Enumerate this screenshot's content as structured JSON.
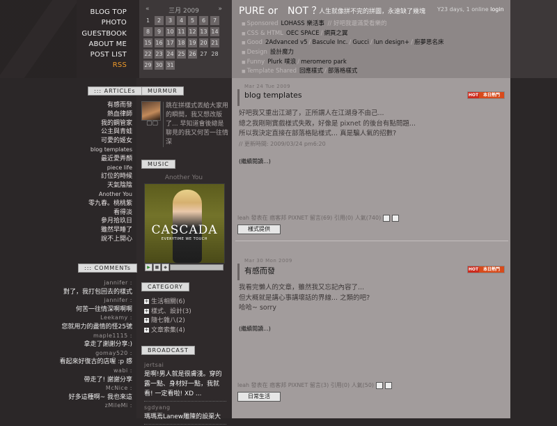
{
  "nav": [
    "BLOG TOP",
    "PHOTO",
    "GUESTBOOK",
    "ABOUT ME",
    "POST LIST",
    "RSS"
  ],
  "calendar": {
    "prev": "«",
    "month": "三月 2009",
    "next": "»",
    "days": [
      "1",
      "2",
      "3",
      "4",
      "5",
      "6",
      "7",
      "8",
      "9",
      "10",
      "11",
      "12",
      "13",
      "14",
      "15",
      "16",
      "17",
      "18",
      "19",
      "20",
      "21",
      "22",
      "23",
      "24",
      "25",
      "26",
      "27",
      "28",
      "29",
      "30",
      "31"
    ],
    "linked": [
      "2",
      "3",
      "4",
      "5",
      "6",
      "7",
      "8",
      "9",
      "10",
      "11",
      "12",
      "13",
      "14",
      "15",
      "16",
      "17",
      "18",
      "19",
      "20",
      "21",
      "22",
      "23",
      "24",
      "25",
      "26",
      "29",
      "30",
      "31"
    ]
  },
  "header": {
    "title": "PURE or　NOT ？",
    "subtitle": "人生就像拼不完的拼圖，永遠缺了幾塊",
    "status_text": "Y23 days, 1 online ",
    "login": "login"
  },
  "link_rows": [
    {
      "label": "Sponsored",
      "links": [
        "LOHASS 樂活事"
      ],
      "note": "// 好吧我還滿愛看樂的"
    },
    {
      "label": "CSS & HTML",
      "links": [
        "OEC SPACE",
        "網頁之翼"
      ],
      "note": ""
    },
    {
      "label": "Good",
      "links": [
        "2Advanced v5",
        "Bascule Inc.",
        "Gucci",
        "lun design+",
        "廚夢思名床"
      ],
      "note": ""
    },
    {
      "label": "Design",
      "links": [
        "設計魔力"
      ],
      "note": ""
    },
    {
      "label": "Funny",
      "links": [
        "Plurk 噗浪",
        "meromero park"
      ],
      "note": ""
    },
    {
      "label": "Template Shared",
      "links": [
        "回應樣式",
        "部落格樣式"
      ],
      "note": ""
    }
  ],
  "articles_title": "::: ARTICLEs",
  "articles": [
    "有感而發",
    "熱血律師",
    "我的鋼管家",
    "公主與青蛙",
    "可愛的姬女",
    "blog templates",
    "最近愛弄顏",
    "piece life",
    "訂位的時候",
    "天氣陰陰",
    "Another You",
    "零九春。桃桃紫",
    "看得淡",
    "參月拾玖日",
    "雖然早睡了",
    "說不上開心"
  ],
  "comments_title": "::: COMMENTs",
  "comments": [
    {
      "who": "jannifer :",
      "msg": "對了，我打包回去的樣式"
    },
    {
      "who": "jannifer :",
      "msg": "何苦一往情深啊啊啊"
    },
    {
      "who": "Leekamy :",
      "msg": "您就用力的盡情的怪25號"
    },
    {
      "who": "maple1115 :",
      "msg": "拿走了謝謝分享:)"
    },
    {
      "who": "gomay520 :",
      "msg": "看起來好復古的店喔 :p 感"
    },
    {
      "who": "wabi :",
      "msg": "帶走了! 謝謝分享"
    },
    {
      "who": "McNice :",
      "msg": "好多這種啊~ 我也來這"
    },
    {
      "who": "zMileMi :",
      "msg": ""
    }
  ],
  "murmur": {
    "title": "MURMUR",
    "icons": "▢▢",
    "text": "跳在拼樣式丟給大家用的瞬間，我又想改版了... 早知道會後總是聊見的我又何苦一往情深"
  },
  "music": {
    "title": "MUSIC",
    "song": "Another You",
    "album_name": "CASCADA",
    "album_tag": "EVERYTIME WE TOUCH",
    "play": "▶",
    "stop": "■"
  },
  "category_title": "CATEGORY",
  "categories": [
    "生活相關(6)",
    "樣式、設計(3)",
    "隨七雜八(2)",
    "文章索集(4)"
  ],
  "broadcast_title": "BROADCAST",
  "broadcast": [
    {
      "who": "jertsai",
      "msg": "是啊!男人就是很膚淺。穿的露一點、身材好一點，我就看! 一定看啦! XD ..."
    },
    {
      "who": "sgdyang",
      "msg": "瑪瑪焉Lanew雕陳的設渠大"
    }
  ],
  "posts": [
    {
      "date": "Mar 24 Tue 2009",
      "title": "blog templates",
      "hot_a": "HOT",
      "hot_b": "本日熱門",
      "lines": [
        "好吧我又重出江湖了，正所謂人在江湖身不由己...",
        "總之我剛剛實戲樣式失敗，好像是 pixnet 的後台有點問題...",
        "所以我決定直接在部落格貼樣式... 真是騙人氣的招數?"
      ],
      "updated": "// 更新時間: 2009/03/24 pm6:20",
      "more": "(繼續閱讀...)",
      "meta": "leah 發表在 痞客邦 PIXNET 留言(69) 引用(0) 人氣(740)",
      "tag": "樣式提供"
    },
    {
      "date": "Mar 30 Mon 2009",
      "title": "有感而發",
      "hot_a": "HOT",
      "hot_b": "本日熱門",
      "lines": [
        "我看完懶人的文章，雖然我又忘記內容了...",
        "但大概就是講心事講壞話的界線... 之類的吧?",
        "哈哈~ sorry"
      ],
      "updated": "",
      "more": "(繼續閱讀...)",
      "meta": "leah 發表在 痞客邦 PIXNET 留言(3) 引用(0) 人氣(50)",
      "tag": "日常生活"
    }
  ]
}
